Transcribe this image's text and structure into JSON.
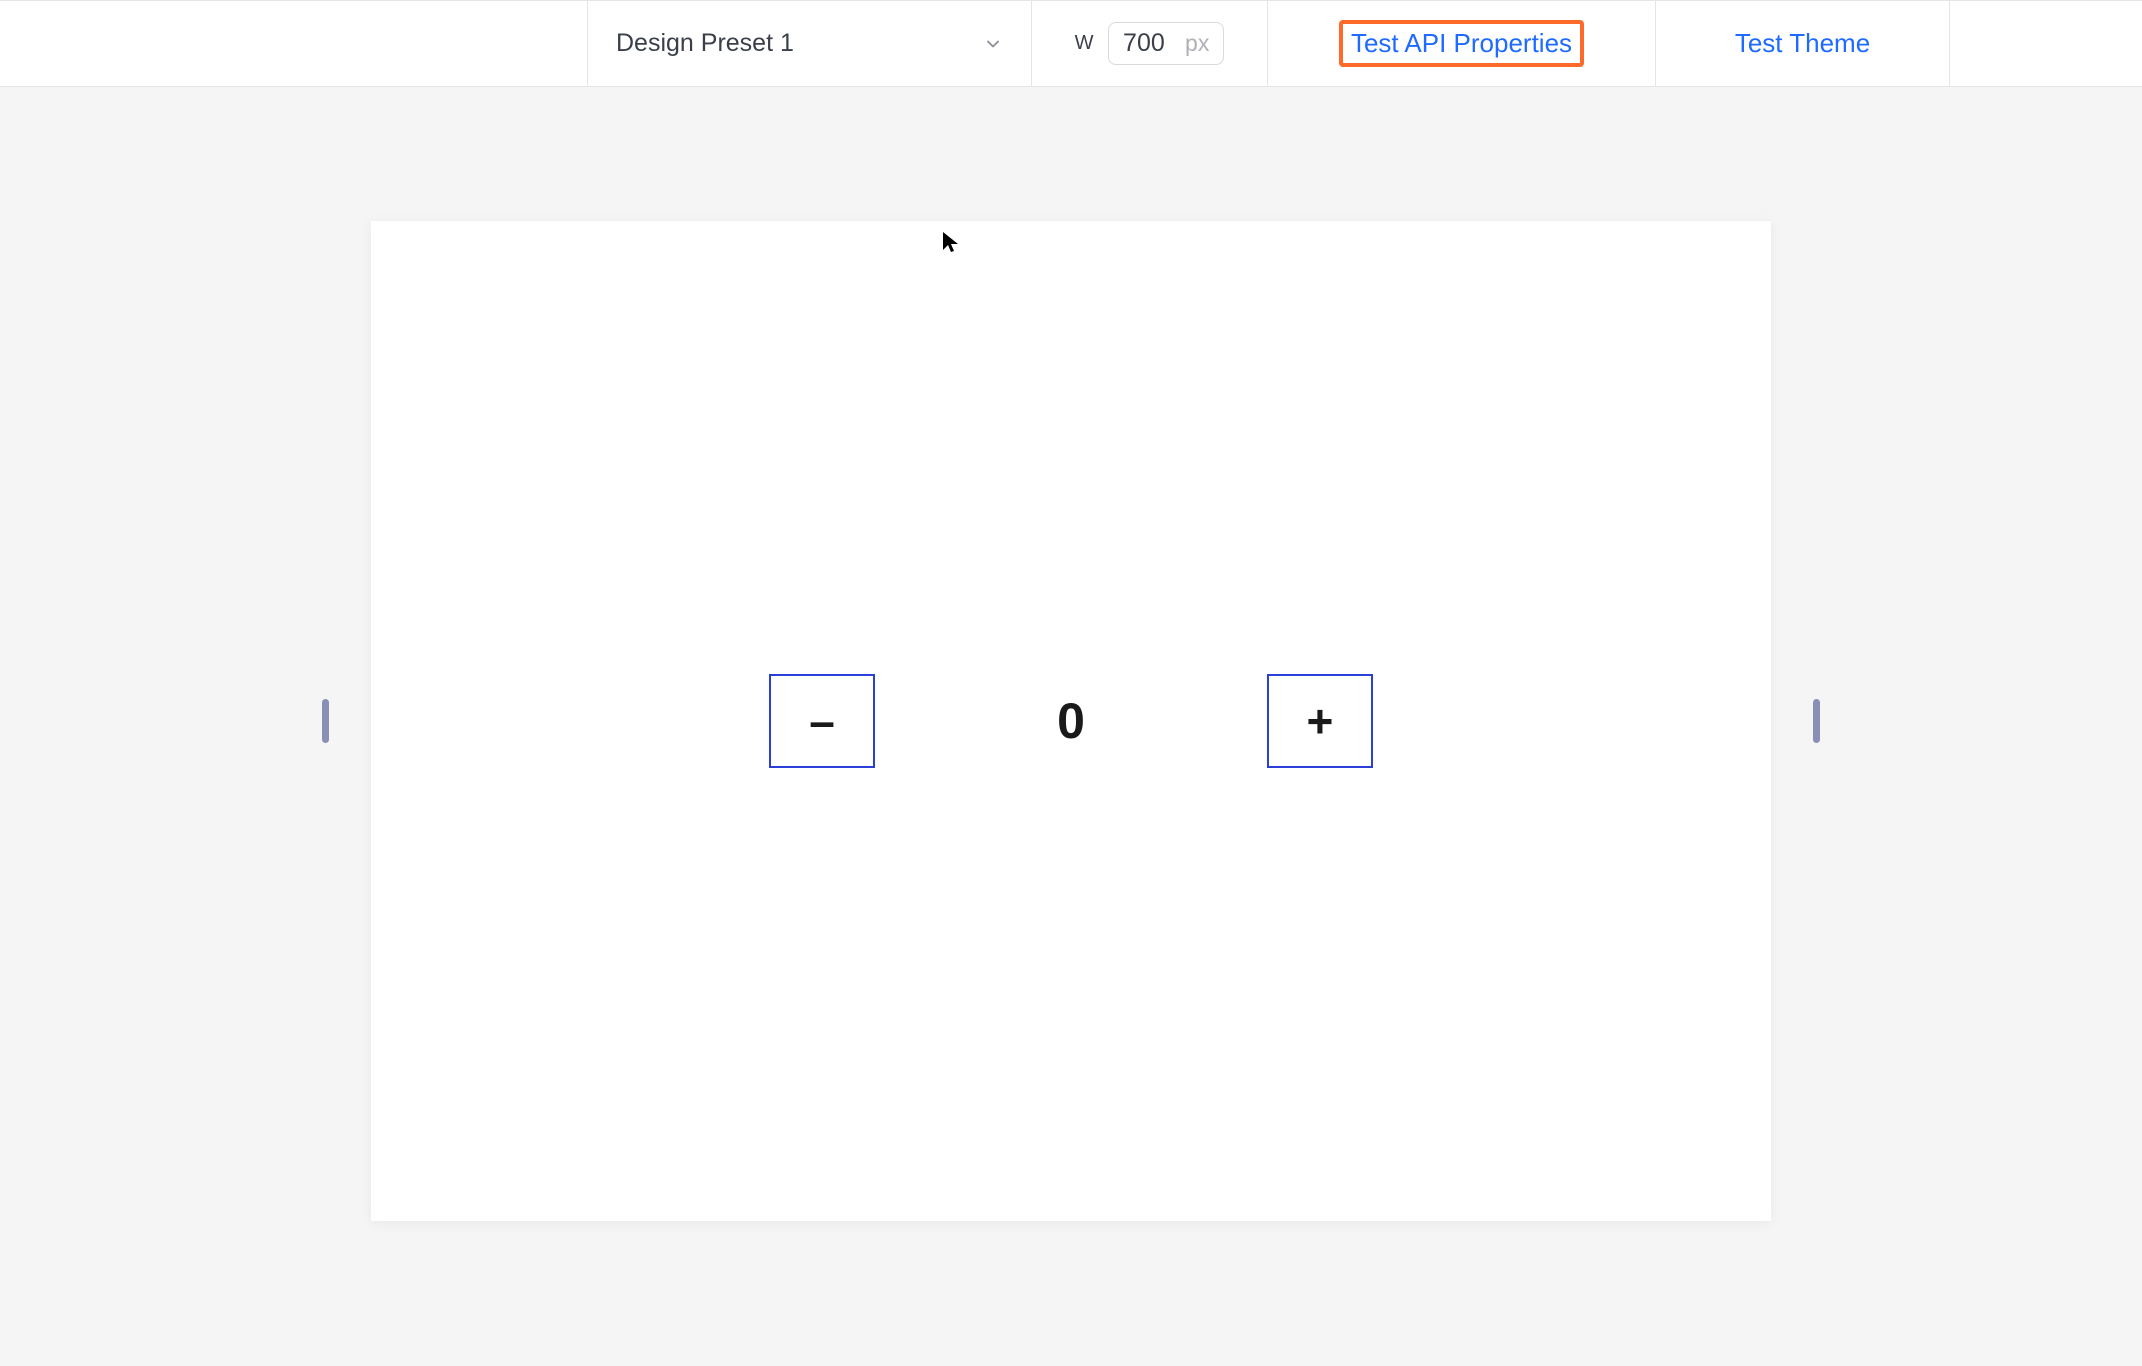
{
  "toolbar": {
    "preset_label": "Design Preset 1",
    "width_label": "W",
    "width_value": "700",
    "width_unit": "px",
    "api_button_label": "Test API Properties",
    "theme_button_label": "Test Theme"
  },
  "counter": {
    "minus_label": "–",
    "value": "0",
    "plus_label": "+"
  }
}
